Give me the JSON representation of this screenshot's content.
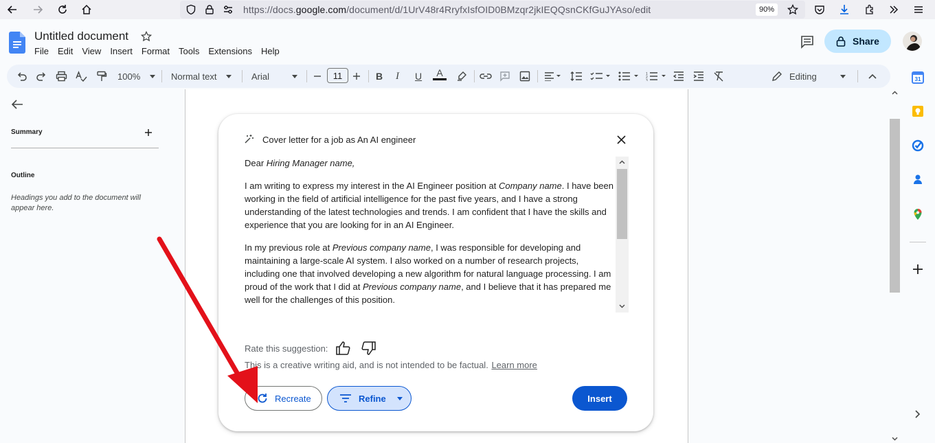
{
  "browser": {
    "url_prefix": "https://docs.",
    "url_domain": "google.com",
    "url_path": "/document/d/1UrV48r4RryfxIsfOID0BMzqr2jkIEQQsnCKfGuJYAso/edit",
    "zoom": "90%"
  },
  "docs": {
    "title": "Untitled document",
    "menu": [
      "File",
      "Edit",
      "View",
      "Insert",
      "Format",
      "Tools",
      "Extensions",
      "Help"
    ],
    "share_label": "Share"
  },
  "toolbar": {
    "zoom": "100%",
    "style": "Normal text",
    "font": "Arial",
    "font_size": "11",
    "mode": "Editing"
  },
  "sidepanel": {
    "summary_label": "Summary",
    "outline_label": "Outline",
    "outline_hint": "Headings you add to the document will appear here."
  },
  "dialog": {
    "prompt": "Cover letter for a job as An AI engineer",
    "greeting_prefix": "Dear ",
    "greeting_placeholder": "Hiring Manager name,",
    "p1_a": "I am writing to express my interest in the AI Engineer position at ",
    "p1_company": "Company name",
    "p1_b": ". I have been working in the field of artificial intelligence for the past five years, and I have a strong understanding of the latest technologies and trends. I am confident that I have the skills and experience that you are looking for in an AI Engineer.",
    "p2_a": "In my previous role at ",
    "p2_prev": "Previous company name",
    "p2_b": ", I was responsible for developing and maintaining a large-scale AI system. I also worked on a number of research projects, including one that involved developing a new algorithm for natural language processing. I am proud of the work that I did at ",
    "p2_prev2": "Previous company name",
    "p2_c": ", and I believe that it has prepared me well for the challenges of this position.",
    "rate_label": "Rate this suggestion:",
    "disclaimer": "This is a creative writing aid, and is not intended to be factual.",
    "learn_more": "Learn more",
    "recreate_label": "Recreate",
    "refine_label": "Refine",
    "insert_label": "Insert"
  },
  "colors": {
    "accent": "#0b57d0",
    "share_bg": "#c2e7ff",
    "annotation_arrow": "#e3111a"
  }
}
